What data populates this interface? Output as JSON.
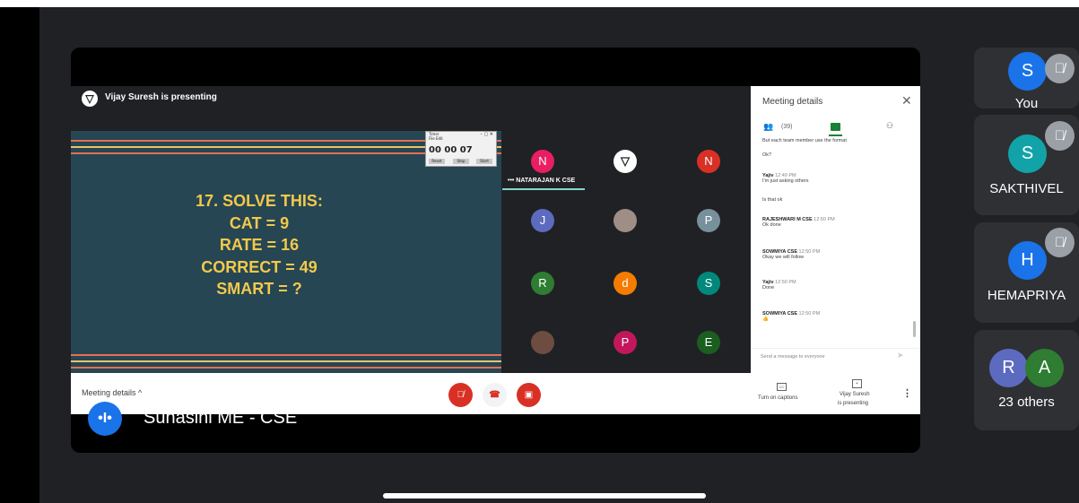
{
  "presenting": {
    "icon": "▽",
    "text": "Vijay Suresh is presenting"
  },
  "slide": {
    "lines": [
      "17. SOLVE THIS:",
      "CAT = 9",
      "RATE = 16",
      "CORRECT = 49",
      "SMART = ?"
    ]
  },
  "timer": {
    "title": "Timer",
    "menu": "File  Edit",
    "digits": "00 00 07",
    "buttons": [
      "Reset",
      "Stop",
      "Start"
    ]
  },
  "tiles": {
    "label": "NATARAJAN K CSE",
    "avatars": [
      {
        "letter": "N",
        "color": "#e91e63"
      },
      {
        "letter": "▽",
        "color": "#ffffff"
      },
      {
        "letter": "N",
        "color": "#d93025"
      },
      {
        "letter": "J",
        "color": "#5c6bc0"
      },
      {
        "letter": "",
        "color": "#9e8e85"
      },
      {
        "letter": "P",
        "color": "#78909c"
      },
      {
        "letter": "R",
        "color": "#2e7d32"
      },
      {
        "letter": "d",
        "color": "#f57c00"
      },
      {
        "letter": "S",
        "color": "#00897b"
      },
      {
        "letter": "",
        "color": "#6d4c41"
      },
      {
        "letter": "P",
        "color": "#c2185b"
      },
      {
        "letter": "E",
        "color": "#1b5e20"
      }
    ]
  },
  "panel": {
    "title": "Meeting details",
    "close": "✕",
    "people_count": "(39)",
    "messages": [
      {
        "text": "But each team member use the format"
      },
      {
        "text": "Ok?"
      },
      {
        "name": "Yajiv",
        "time": "12:49 PM",
        "text": "I'm just asking others"
      },
      {
        "text": "Is that ok"
      },
      {
        "name": "RAJESHWARI M CSE",
        "time": "12:50 PM",
        "text": "Ok done"
      },
      {
        "name": "SOWMIYA CSE",
        "time": "12:50 PM",
        "text": "Okay we will follow"
      },
      {
        "name": "Yajiv",
        "time": "12:50 PM",
        "text": "Done"
      },
      {
        "name": "SOWMIYA CSE",
        "time": "12:50 PM",
        "text": "👍"
      }
    ],
    "send_placeholder": "Send a message to everyone"
  },
  "controls": {
    "meeting_details": "Meeting details ^",
    "captions": "Turn on captions",
    "presenting_1": "Vijay Suresh",
    "presenting_2": "is presenting"
  },
  "self": {
    "initial": "•I•",
    "name": "Suhasini ME - CSE"
  },
  "side": [
    {
      "initial": "S",
      "label": "You",
      "color": "#1a73e8"
    },
    {
      "initial": "S",
      "label": "SAKTHIVEL",
      "color": "#12a3a8"
    },
    {
      "initial": "H",
      "label": "HEMAPRIYA",
      "color": "#1a73e8"
    },
    {
      "initial": "R",
      "initial2": "A",
      "label": "23 others",
      "color": "#5c6bc0",
      "color2": "#2e7d32"
    }
  ]
}
